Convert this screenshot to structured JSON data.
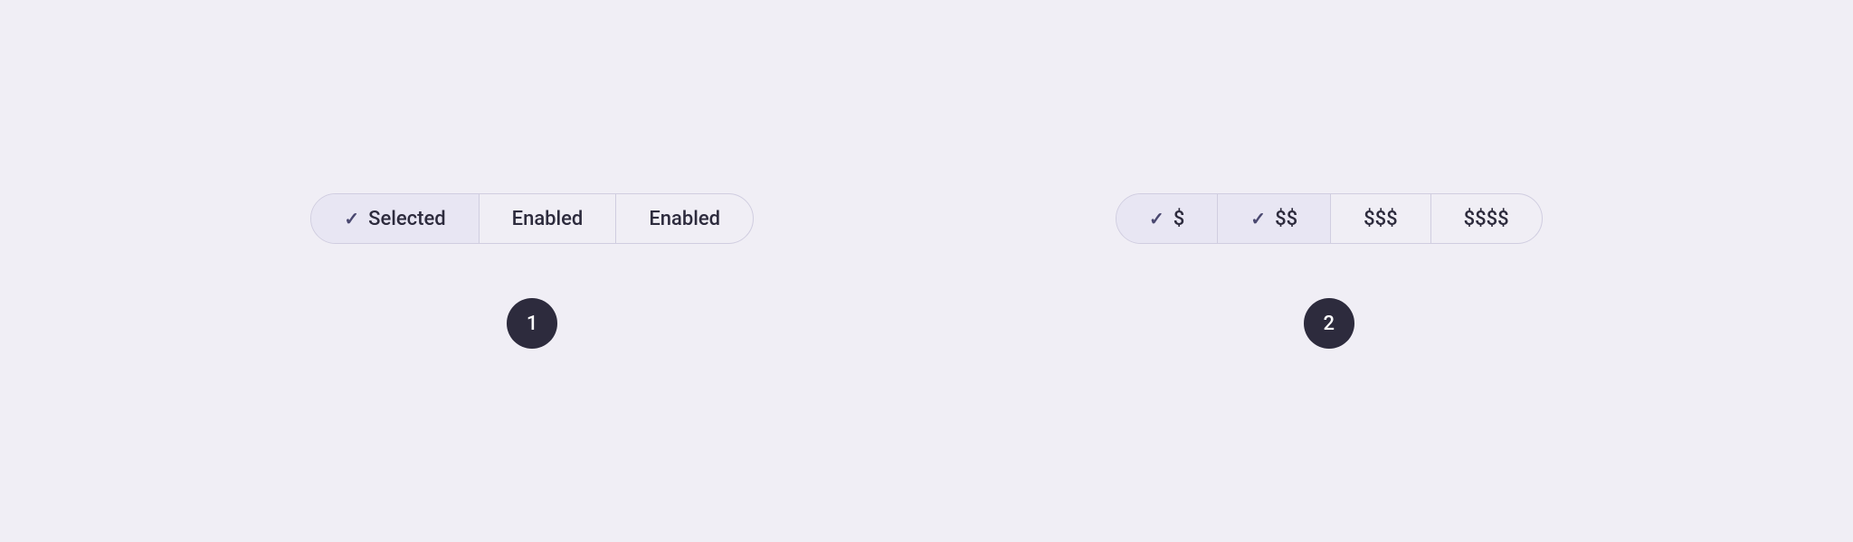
{
  "background_color": "#f0eef5",
  "example1": {
    "segments": [
      {
        "id": "selected",
        "label": "Selected",
        "state": "selected",
        "has_check": true
      },
      {
        "id": "enabled1",
        "label": "Enabled",
        "state": "enabled",
        "has_check": false
      },
      {
        "id": "enabled2",
        "label": "Enabled",
        "state": "enabled",
        "has_check": false
      }
    ],
    "badge": "1"
  },
  "example2": {
    "segments": [
      {
        "id": "dollar1",
        "label": "$",
        "state": "selected",
        "has_check": true
      },
      {
        "id": "dollar2",
        "label": "$$",
        "state": "selected",
        "has_check": true
      },
      {
        "id": "dollar3",
        "label": "$$$",
        "state": "enabled",
        "has_check": false
      },
      {
        "id": "dollar4",
        "label": "$$$$",
        "state": "enabled",
        "has_check": false
      }
    ],
    "badge": "2"
  }
}
